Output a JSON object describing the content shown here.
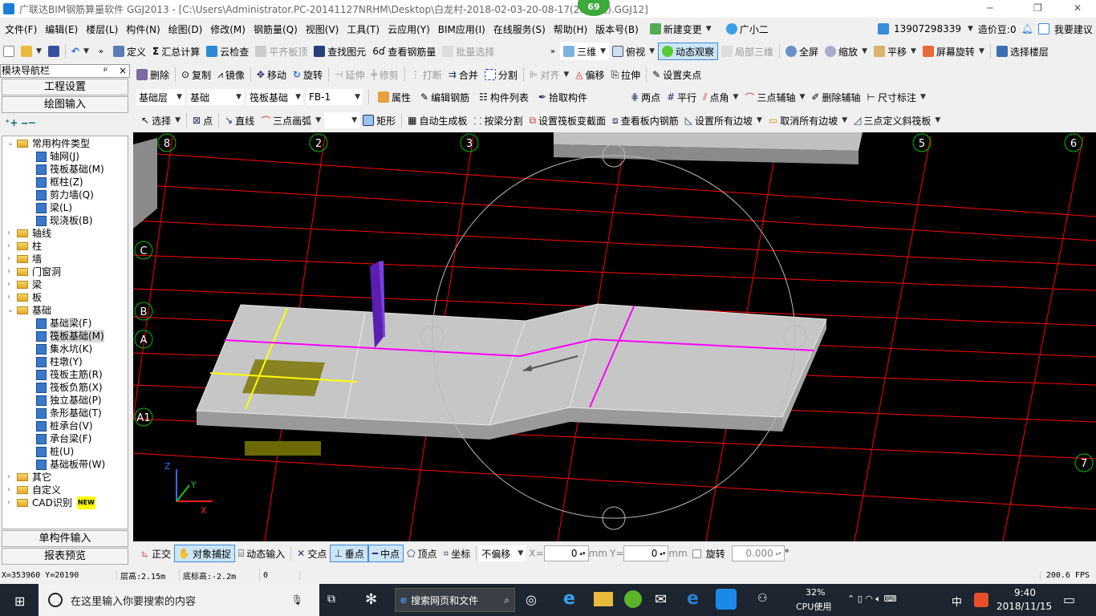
{
  "title_bar": {
    "app_title": "广联达BIM钢筋算量软件 GGJ2013 - [C:\\Users\\Administrator.PC-20141127NRHM\\Desktop\\白龙村-2018-02-03-20-08-17(2600版).GGJ12]",
    "badge": "69",
    "minimize": "─",
    "restore": "❐",
    "close": "✕"
  },
  "menu": [
    "文件(F)",
    "编辑(E)",
    "楼层(L)",
    "构件(N)",
    "绘图(D)",
    "修改(M)",
    "钢筋量(Q)",
    "视图(V)",
    "工具(T)",
    "云应用(Y)",
    "BIM应用(I)",
    "在线服务(S)",
    "帮助(H)",
    "版本号(B)"
  ],
  "menu_extras": {
    "new_change": "新建变更",
    "assistant": "广小二",
    "account": "13907298339",
    "beans": "造价豆:0",
    "suggest": "我要建议"
  },
  "toolbar1": {
    "left": [
      "定义",
      "汇总计算",
      "云检查",
      "平齐板顶",
      "查找图元",
      "查看钢筋量",
      "批量选择"
    ],
    "right": [
      "三维",
      "俯视",
      "动态观察",
      "局部三维",
      "全屏",
      "缩放",
      "平移",
      "屏幕旋转",
      "选择楼层"
    ]
  },
  "toolbar_edit": [
    "删除",
    "复制",
    "镜像",
    "移动",
    "旋转",
    "延伸",
    "修剪",
    "打断",
    "合并",
    "分割",
    "对齐",
    "偏移",
    "拉伸",
    "设置夹点"
  ],
  "toolbar_component": {
    "floor": "基础层",
    "category": "基础",
    "type": "筏板基础",
    "name": "FB-1",
    "actions": [
      "属性",
      "编辑钢筋",
      "构件列表",
      "拾取构件"
    ],
    "axis_tools": [
      "两点",
      "平行",
      "点角",
      "三点辅轴",
      "删除辅轴",
      "尺寸标注"
    ]
  },
  "toolbar_draw": [
    "选择",
    "点",
    "直线",
    "三点画弧",
    "",
    "矩形",
    "自动生成板",
    "按梁分割",
    "设置筏板变截面",
    "查看板内钢筋",
    "设置所有边坡",
    "取消所有边坡",
    "三点定义斜筏板"
  ],
  "nav_panel": {
    "title": "模块导航栏",
    "pin": "ᵖ",
    "close": "×",
    "project_settings": "工程设置",
    "drawing_input": "绘图输入",
    "single_input": "单构件输入",
    "report_preview": "报表预览",
    "tree": [
      {
        "label": "常用构件类型",
        "level": 0,
        "expanded": true
      },
      {
        "label": "轴网(J)",
        "level": 1
      },
      {
        "label": "筏板基础(M)",
        "level": 1
      },
      {
        "label": "框柱(Z)",
        "level": 1
      },
      {
        "label": "剪力墙(Q)",
        "level": 1
      },
      {
        "label": "梁(L)",
        "level": 1
      },
      {
        "label": "现浇板(B)",
        "level": 1
      },
      {
        "label": "轴线",
        "level": 0
      },
      {
        "label": "柱",
        "level": 0
      },
      {
        "label": "墙",
        "level": 0
      },
      {
        "label": "门窗洞",
        "level": 0
      },
      {
        "label": "梁",
        "level": 0
      },
      {
        "label": "板",
        "level": 0
      },
      {
        "label": "基础",
        "level": 0,
        "expanded": true
      },
      {
        "label": "基础梁(F)",
        "level": 1
      },
      {
        "label": "筏板基础(M)",
        "level": 1,
        "selected": true
      },
      {
        "label": "集水坑(K)",
        "level": 1
      },
      {
        "label": "柱墩(Y)",
        "level": 1
      },
      {
        "label": "筏板主筋(R)",
        "level": 1
      },
      {
        "label": "筏板负筋(X)",
        "level": 1
      },
      {
        "label": "独立基础(P)",
        "level": 1
      },
      {
        "label": "条形基础(T)",
        "level": 1
      },
      {
        "label": "桩承台(V)",
        "level": 1
      },
      {
        "label": "承台梁(F)",
        "level": 1
      },
      {
        "label": "桩(U)",
        "level": 1
      },
      {
        "label": "基础板带(W)",
        "level": 1
      },
      {
        "label": "其它",
        "level": 0
      },
      {
        "label": "自定义",
        "level": 0
      },
      {
        "label": "CAD识别",
        "level": 0,
        "badge": "NEW"
      }
    ]
  },
  "viewport": {
    "axis_labels_top": [
      "8",
      "2",
      "3",
      "5",
      "6"
    ],
    "axis_labels_left": [
      "C",
      "B",
      "A",
      "A1"
    ],
    "axis_label_right": "7",
    "axes": {
      "z": "Z",
      "y": "Y",
      "x": "X"
    },
    "colors": {
      "grid": "#ff0000",
      "slab": "#c8c8c8",
      "beam": "#ff00ff",
      "column": "#6a1fc9",
      "background": "#000000"
    }
  },
  "snap_bar": {
    "items": [
      "正交",
      "对象捕捉",
      "动态输入",
      "交点",
      "垂点",
      "中点",
      "顶点",
      "坐标"
    ],
    "offset_mode": "不偏移",
    "x_label": "X=",
    "x_value": "0",
    "y_label": "Y=",
    "y_value": "0",
    "unit": "mm",
    "rotate_label": "旋转",
    "rotate_value": "0.000",
    "degree": "°"
  },
  "status_bar": {
    "coords": "X=353960  Y=20190",
    "floor_height": "层高:2.15m",
    "bottom_elev": "底标高:-2.2m",
    "value": "0",
    "fps": "200.6 FPS"
  },
  "taskbar": {
    "search_placeholder": "在这里输入你要搜索的内容",
    "browser_search": "搜索网页和文件",
    "cpu": "32%",
    "cpu_label": "CPU使用",
    "ime": "中",
    "time": "9:40",
    "date": "2018/11/15"
  }
}
